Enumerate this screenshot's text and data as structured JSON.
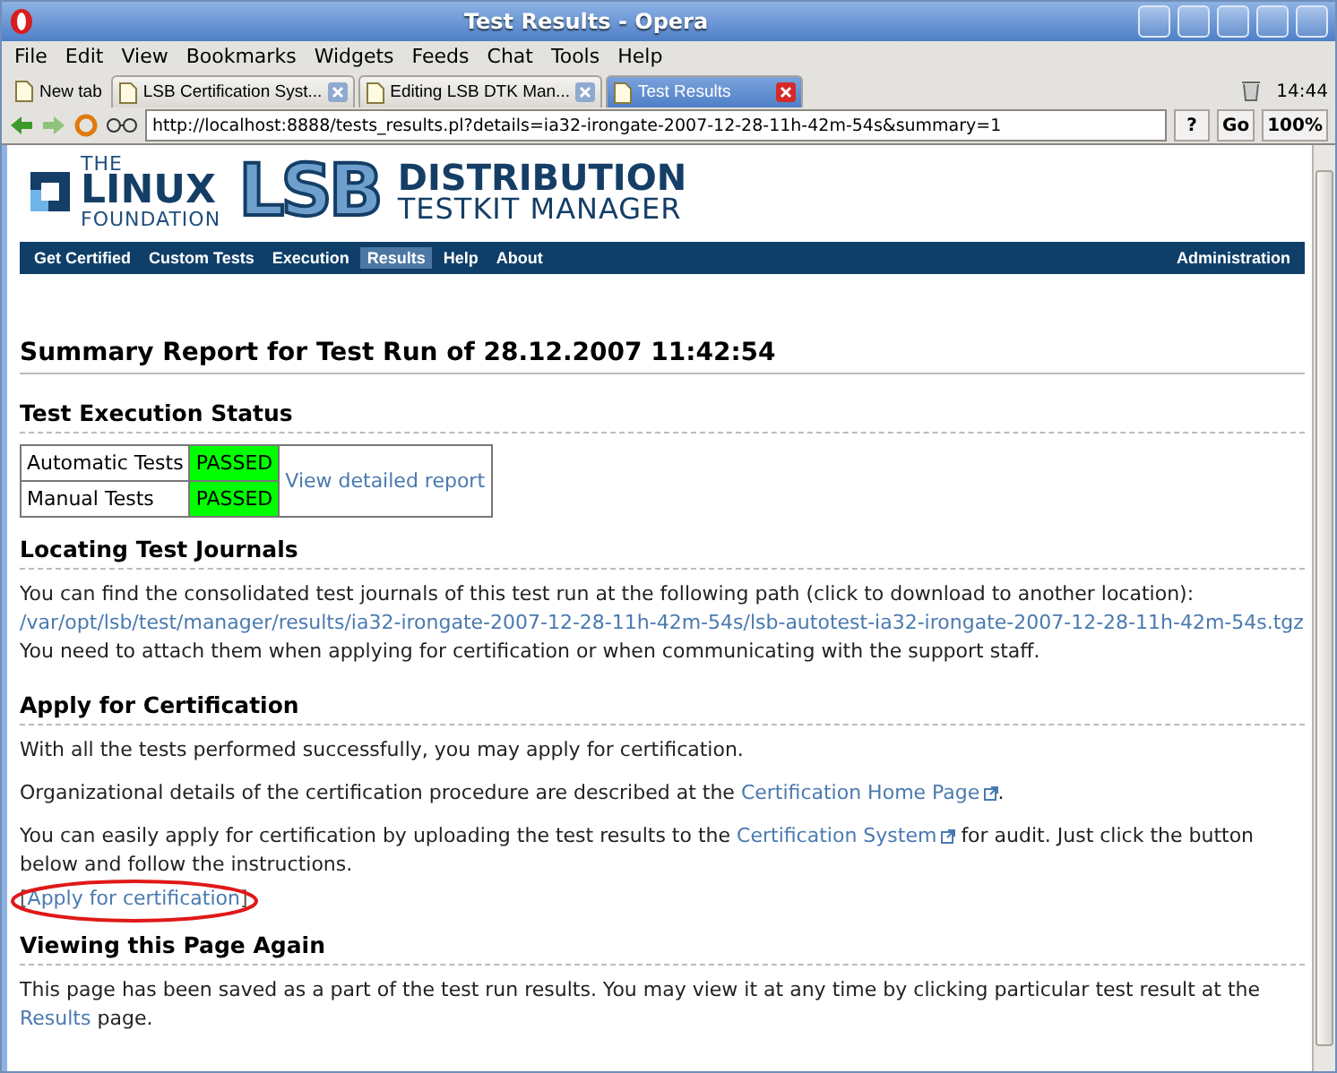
{
  "window": {
    "title": "Test Results - Opera"
  },
  "menu": [
    "File",
    "Edit",
    "View",
    "Bookmarks",
    "Widgets",
    "Feeds",
    "Chat",
    "Tools",
    "Help"
  ],
  "tabs": [
    {
      "label": "New tab",
      "selected": false,
      "kind": "new"
    },
    {
      "label": "LSB Certification Syst...",
      "selected": false,
      "kind": "page"
    },
    {
      "label": "Editing LSB DTK Man...",
      "selected": false,
      "kind": "page"
    },
    {
      "label": "Test Results",
      "selected": true,
      "kind": "page"
    }
  ],
  "clock": "14:44",
  "address": {
    "value": "http://localhost:8888/tests_results.pl?details=ia32-irongate-2007-12-28-11h-42m-54s&summary=1",
    "go": "Go",
    "zoom": "100%",
    "help": "?"
  },
  "logo": {
    "the": "THE",
    "linux": "LINUX",
    "foundation": "FOUNDATION",
    "lsb": "LSB",
    "distribution": "DISTRIBUTION",
    "testkit": "TESTKIT MANAGER"
  },
  "nav": [
    {
      "label": "Get Certified",
      "selected": false
    },
    {
      "label": "Custom Tests",
      "selected": false
    },
    {
      "label": "Execution",
      "selected": false
    },
    {
      "label": "Results",
      "selected": true
    },
    {
      "label": "Help",
      "selected": false
    },
    {
      "label": "About",
      "selected": false
    }
  ],
  "nav_right": "Administration",
  "page_title": "Summary Report for Test Run of 28.12.2007 11:42:54",
  "status": {
    "heading": "Test Execution Status",
    "rows": [
      {
        "name": "Automatic Tests",
        "result": "PASSED"
      },
      {
        "name": "Manual Tests",
        "result": "PASSED"
      }
    ],
    "link": "View detailed report"
  },
  "journals": {
    "heading": "Locating Test Journals",
    "text": "You can find the consolidated test journals of this test run at the following path (click to download to another location):",
    "path": "/var/opt/lsb/test/manager/results/ia32-irongate-2007-12-28-11h-42m-54s/lsb-autotest-ia32-irongate-2007-12-28-11h-42m-54s.tgz",
    "note": "You need to attach them when applying for certification or when communicating with the support staff."
  },
  "apply": {
    "heading": "Apply for Certification",
    "p1": "With all the tests performed successfully, you may apply for certification.",
    "p2_before": "Organizational details of the certification procedure are described at the",
    "p2_link": "Certification Home Page",
    "p2_after": ".",
    "p3_before": "You can easily apply for certification by uploading the test results to the",
    "p3_link": "Certification System",
    "p3_after": "for audit. Just click the button below and follow the instructions.",
    "button_open": "[",
    "button": "Apply for certification",
    "button_close": "]"
  },
  "again": {
    "heading": "Viewing this Page Again",
    "before": "This page has been saved as a part of the test run results. You may view it at any time by clicking particular test result at the",
    "link": "Results",
    "after": "page."
  }
}
